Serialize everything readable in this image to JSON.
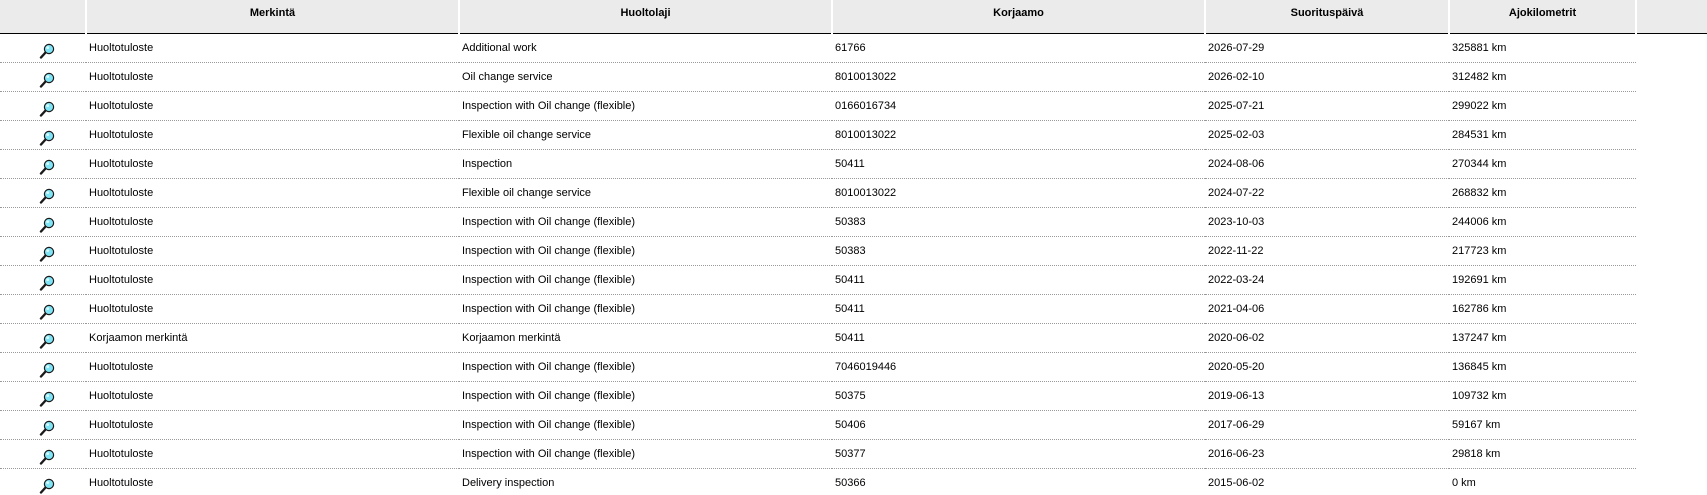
{
  "columns": {
    "merkinta": "Merkintä",
    "huoltolaji": "Huoltolaji",
    "korjaamo": "Korjaamo",
    "suorituspaiva": "Suorituspäivä",
    "ajokilometrit": "Ajokilometrit"
  },
  "icons": {
    "row_action": "magnifier-icon"
  },
  "rows": [
    {
      "merkinta": "Huoltotuloste",
      "huoltolaji": "Additional work",
      "korjaamo": "61766",
      "suorituspaiva": "2026-07-29",
      "ajokilometrit": "325881 km"
    },
    {
      "merkinta": "Huoltotuloste",
      "huoltolaji": "Oil change service",
      "korjaamo": "8010013022",
      "suorituspaiva": "2026-02-10",
      "ajokilometrit": "312482 km"
    },
    {
      "merkinta": "Huoltotuloste",
      "huoltolaji": "Inspection with Oil change (flexible)",
      "korjaamo": "0166016734",
      "suorituspaiva": "2025-07-21",
      "ajokilometrit": "299022 km"
    },
    {
      "merkinta": "Huoltotuloste",
      "huoltolaji": "Flexible oil change service",
      "korjaamo": "8010013022",
      "suorituspaiva": "2025-02-03",
      "ajokilometrit": "284531 km"
    },
    {
      "merkinta": "Huoltotuloste",
      "huoltolaji": "Inspection",
      "korjaamo": "50411",
      "suorituspaiva": "2024-08-06",
      "ajokilometrit": "270344 km"
    },
    {
      "merkinta": "Huoltotuloste",
      "huoltolaji": "Flexible oil change service",
      "korjaamo": "8010013022",
      "suorituspaiva": "2024-07-22",
      "ajokilometrit": "268832 km"
    },
    {
      "merkinta": "Huoltotuloste",
      "huoltolaji": "Inspection with Oil change (flexible)",
      "korjaamo": "50383",
      "suorituspaiva": "2023-10-03",
      "ajokilometrit": "244006 km"
    },
    {
      "merkinta": "Huoltotuloste",
      "huoltolaji": "Inspection with Oil change (flexible)",
      "korjaamo": "50383",
      "suorituspaiva": "2022-11-22",
      "ajokilometrit": "217723 km"
    },
    {
      "merkinta": "Huoltotuloste",
      "huoltolaji": "Inspection with Oil change (flexible)",
      "korjaamo": "50411",
      "suorituspaiva": "2022-03-24",
      "ajokilometrit": "192691 km"
    },
    {
      "merkinta": "Huoltotuloste",
      "huoltolaji": "Inspection with Oil change (flexible)",
      "korjaamo": "50411",
      "suorituspaiva": "2021-04-06",
      "ajokilometrit": "162786 km"
    },
    {
      "merkinta": "Korjaamon merkintä",
      "huoltolaji": "Korjaamon merkintä",
      "korjaamo": "50411",
      "suorituspaiva": "2020-06-02",
      "ajokilometrit": "137247 km"
    },
    {
      "merkinta": "Huoltotuloste",
      "huoltolaji": "Inspection with Oil change (flexible)",
      "korjaamo": "7046019446",
      "suorituspaiva": "2020-05-20",
      "ajokilometrit": "136845 km"
    },
    {
      "merkinta": "Huoltotuloste",
      "huoltolaji": "Inspection with Oil change (flexible)",
      "korjaamo": "50375",
      "suorituspaiva": "2019-06-13",
      "ajokilometrit": "109732 km"
    },
    {
      "merkinta": "Huoltotuloste",
      "huoltolaji": "Inspection with Oil change (flexible)",
      "korjaamo": "50406",
      "suorituspaiva": "2017-06-29",
      "ajokilometrit": "59167 km"
    },
    {
      "merkinta": "Huoltotuloste",
      "huoltolaji": "Inspection with Oil change (flexible)",
      "korjaamo": "50377",
      "suorituspaiva": "2016-06-23",
      "ajokilometrit": "29818 km"
    },
    {
      "merkinta": "Huoltotuloste",
      "huoltolaji": "Delivery inspection",
      "korjaamo": "50366",
      "suorituspaiva": "2015-06-02",
      "ajokilometrit": "0 km"
    }
  ]
}
